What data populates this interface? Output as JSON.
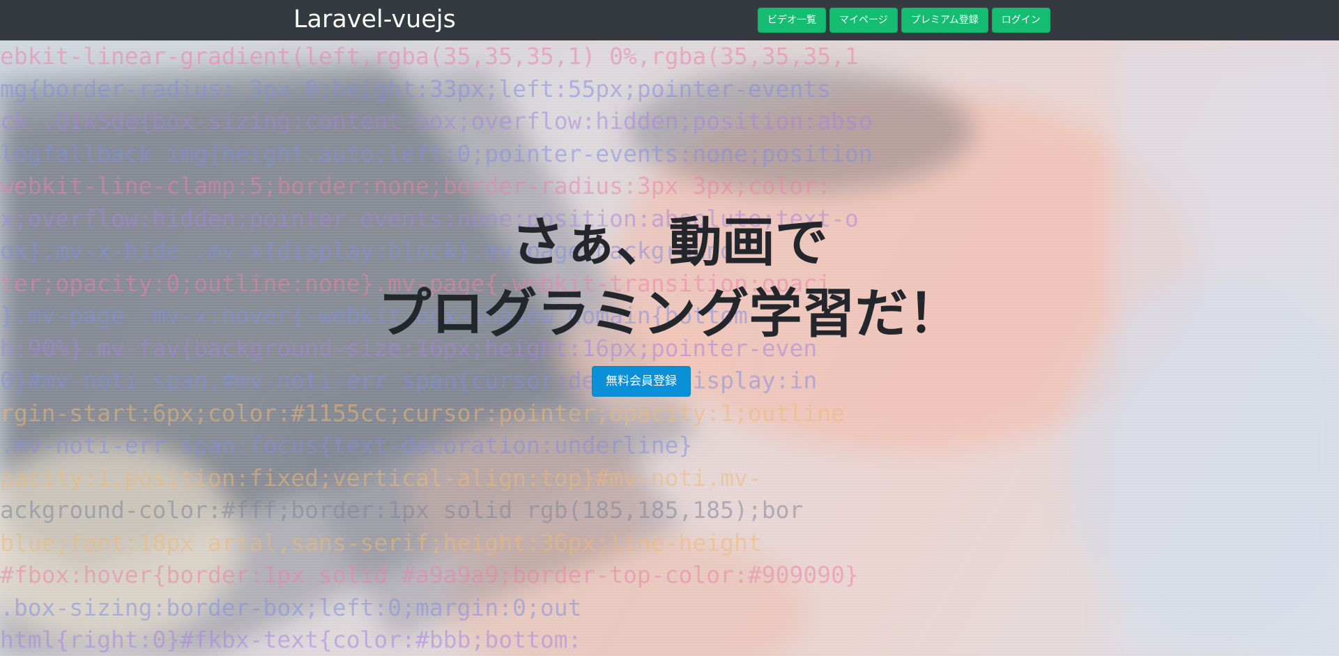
{
  "navbar": {
    "brand": "Laravel-vuejs",
    "buttons": [
      {
        "label": "ビデオ一覧"
      },
      {
        "label": "マイページ"
      },
      {
        "label": "プレミアム登録"
      },
      {
        "label": "ログイン"
      }
    ],
    "button_color": "#14bd72",
    "background_color": "#343a40"
  },
  "hero": {
    "headline_line1": "さぁ、動画で",
    "headline_line2": "プログラミング学習だ！",
    "cta_label": "無料会員登録",
    "cta_color": "#0b8fd6",
    "code_lines": [
      "ebkit-linear-gradient(left,rgba(35,35,35,1) 0%,rgba(35,35,35,1",
      "mg{border-radius:   3px 0;height:33px;left:55px;pointer-events",
      "ck .QIkSde{box-sizing:content-box;overflow:hidden;position:abso",
      "logfallback img{height:auto;left:0;pointer-events:none;position",
      "webkit-line-clamp:5;border:none;border-radius:3px 3px;color:",
      "x;overflow:hidden;pointer-events:none;position:absolute;text-o",
      "ox}.mv-x-hide .mv-x{display:block}.mv-page-background-",
      "ter;opacity:0;outline:none}.mv-page{-webkit-transition:opaci",
      "}.mv-page .mv-x:hover{-webkit-box-shadow domain{bottom",
      "h:90%}.mv-fav{background-size:16px;height:16px;pointer-even",
      "0}#mv-noti span,#mv-noti-err span{cursor:default;display:in",
      "rgin-start:6px;color:#1155cc;cursor:pointer;opacity:1;outline",
      "  .mv-noti-err span:focus{text-decoration:underline}",
      "pacity:1,position:fixed;vertical-align:top}#mv-noti.mv-",
      "ackground-color:#fff;border:1px solid rgb(185,185,185);bor",
      "  blue;font:18px arial,sans-serif;height:36px;line-height",
      "#fbox:hover{border:1px solid #a9a9a9;border-top-color:#909090}",
      ".box-sizing:border-box;left:0;margin:0;out",
      "html{right:0}#fkbx-text{color:#bbb;bottom:"
    ]
  }
}
